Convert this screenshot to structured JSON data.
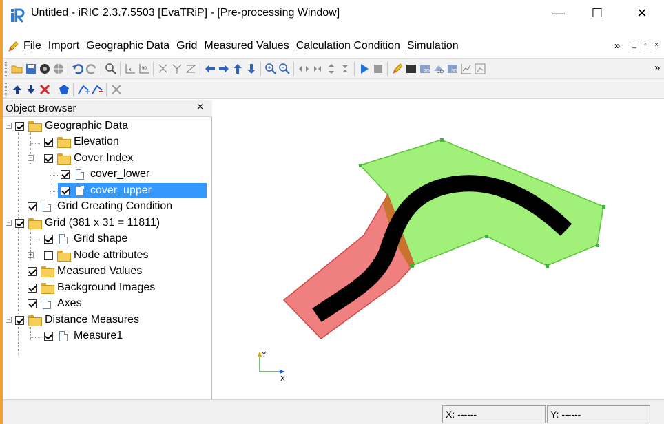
{
  "window": {
    "title": "Untitled - iRIC 2.3.7.5503 [EvaTRiP] - [Pre-processing Window]",
    "minimize": "—",
    "maximize": "☐",
    "close": "✕"
  },
  "menu": {
    "items": [
      {
        "u": "F",
        "rest": "ile"
      },
      {
        "u": "I",
        "rest": "mport"
      },
      {
        "pre": "G",
        "u": "e",
        "rest": "ographic Data"
      },
      {
        "u": "G",
        "rest": "rid"
      },
      {
        "u": "M",
        "rest": "easured Values"
      },
      {
        "u": "C",
        "rest": "alculation Condition"
      },
      {
        "u": "S",
        "rest": "imulation"
      }
    ],
    "overflow": "»"
  },
  "toolbar": {
    "overflow": "»"
  },
  "object_browser": {
    "title": "Object Browser",
    "close": "×",
    "tree": [
      {
        "label": "Geographic Data",
        "icon": "folder-icon",
        "checked": true
      },
      {
        "label": "Elevation",
        "icon": "folder-icon",
        "checked": true
      },
      {
        "label": "Cover Index",
        "icon": "folder-icon",
        "checked": true
      },
      {
        "label": "cover_lower",
        "icon": "document-icon",
        "checked": true
      },
      {
        "label": "cover_upper",
        "icon": "document-icon",
        "checked": true,
        "selected": true
      },
      {
        "label": "Grid Creating Condition",
        "icon": "document-icon",
        "checked": true
      },
      {
        "label": "Grid (381 x 31 = 11811)",
        "icon": "folder-icon",
        "checked": true
      },
      {
        "label": "Grid shape",
        "icon": "document-icon",
        "checked": true
      },
      {
        "label": "Node attributes",
        "icon": "folder-icon",
        "checked": false
      },
      {
        "label": "Measured Values",
        "icon": "folder-icon",
        "checked": true
      },
      {
        "label": "Background Images",
        "icon": "folder-icon",
        "checked": true
      },
      {
        "label": "Axes",
        "icon": "document-icon",
        "checked": true
      },
      {
        "label": "Distance Measures",
        "icon": "folder-icon",
        "checked": true
      },
      {
        "label": "Measure1",
        "icon": "document-icon",
        "checked": true
      }
    ]
  },
  "canvas": {
    "axis_y_label": "Y",
    "axis_x_label": "X",
    "colors": {
      "upper_polygon": "#a0f07a",
      "lower_polygon": "#f07f7f",
      "overlap": "#c8742e",
      "grid_shape": "#000000"
    }
  },
  "status": {
    "x": "X: ------",
    "y": "Y: ------"
  }
}
